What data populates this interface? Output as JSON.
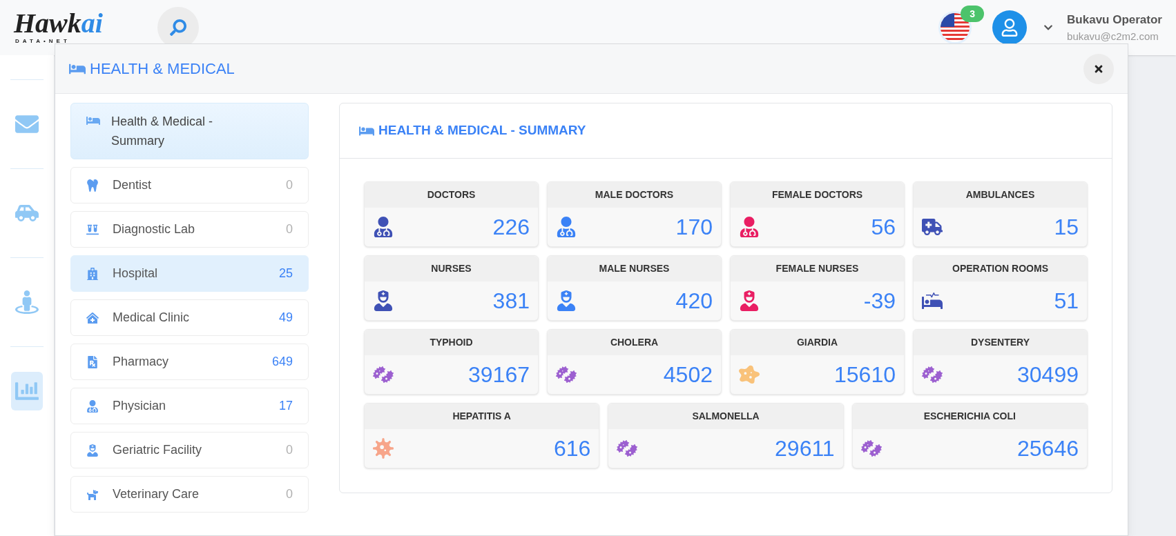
{
  "logo": {
    "name": "Hawk",
    "accent": "ai",
    "tagline": "DATA•NET"
  },
  "header": {
    "notifications": "3",
    "user_name": "Bukavu Operator",
    "user_email": "bukavu@c2m2.com"
  },
  "rail": [
    {
      "kind": "mail",
      "selected": false
    },
    {
      "kind": "vehicles",
      "selected": false
    },
    {
      "kind": "person",
      "selected": false
    },
    {
      "kind": "chart",
      "selected": true
    }
  ],
  "modal": {
    "title": "HEALTH & MEDICAL",
    "summary_item": {
      "label": "Health & Medical - Summary",
      "selected": true
    },
    "categories": [
      {
        "kind": "tooth",
        "label": "Dentist",
        "count": "0",
        "selected": false,
        "dimmed": true
      },
      {
        "kind": "lab",
        "label": "Diagnostic Lab",
        "count": "0",
        "selected": false,
        "dimmed": true
      },
      {
        "kind": "hospital",
        "label": "Hospital",
        "count": "25",
        "selected": true,
        "dimmed": false
      },
      {
        "kind": "clinic",
        "label": "Medical Clinic",
        "count": "49",
        "selected": false,
        "dimmed": false
      },
      {
        "kind": "pharmacy",
        "label": "Pharmacy",
        "count": "649",
        "selected": false,
        "dimmed": false
      },
      {
        "kind": "physician",
        "label": "Physician",
        "count": "17",
        "selected": false,
        "dimmed": false
      },
      {
        "kind": "geriatric",
        "label": "Geriatric Facility",
        "count": "0",
        "selected": false,
        "dimmed": true
      },
      {
        "kind": "dog",
        "label": "Veterinary Care",
        "count": "0",
        "selected": false,
        "dimmed": true
      }
    ],
    "panel_title": "HEALTH & MEDICAL - SUMMARY",
    "stats": [
      {
        "label": "DOCTORS",
        "value": "226",
        "kind": "doctor",
        "color": "#3f51b5"
      },
      {
        "label": "MALE DOCTORS",
        "value": "170",
        "kind": "doctor",
        "color": "#3b82f6"
      },
      {
        "label": "FEMALE DOCTORS",
        "value": "56",
        "kind": "doctor",
        "color": "#e91e63"
      },
      {
        "label": "AMBULANCES",
        "value": "15",
        "kind": "ambulance",
        "color": "#3f51b5"
      },
      {
        "label": "NURSES",
        "value": "381",
        "kind": "nurse",
        "color": "#3f51b5"
      },
      {
        "label": "MALE NURSES",
        "value": "420",
        "kind": "nurse",
        "color": "#3b82f6"
      },
      {
        "label": "FEMALE NURSES",
        "value": "-39",
        "kind": "nurse",
        "color": "#e91e63"
      },
      {
        "label": "OPERATION ROOMS",
        "value": "51",
        "kind": "bed",
        "color": "#3f51b5"
      },
      {
        "label": "TYPHOID",
        "value": "39167",
        "kind": "bacteria",
        "color": "#9c5fd0"
      },
      {
        "label": "CHOLERA",
        "value": "4502",
        "kind": "bacteria",
        "color": "#9c5fd0"
      },
      {
        "label": "GIARDIA",
        "value": "15610",
        "kind": "amoeba",
        "color": "#f9c27a"
      },
      {
        "label": "DYSENTERY",
        "value": "30499",
        "kind": "bacteria",
        "color": "#9c5fd0"
      },
      {
        "label": "HEPATITIS A",
        "value": "616",
        "kind": "virus",
        "color": "#f7a58a"
      },
      {
        "label": "SALMONELLA",
        "value": "29611",
        "kind": "bacteria",
        "color": "#9c5fd0"
      },
      {
        "label": "ESCHERICHIA COLI",
        "value": "25646",
        "kind": "bacteria",
        "color": "#9c5fd0"
      }
    ]
  }
}
